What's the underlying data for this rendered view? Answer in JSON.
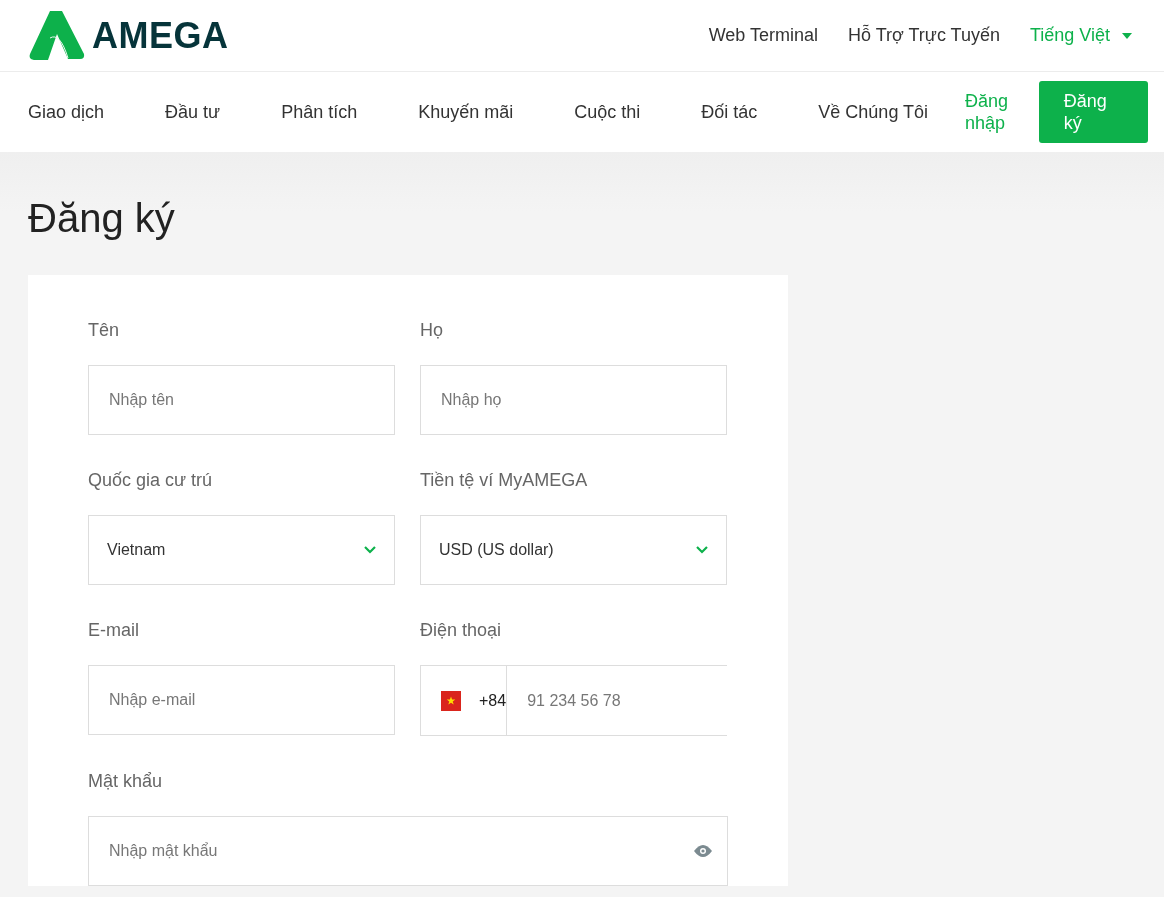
{
  "header": {
    "logo": "AMEGA",
    "top_links": [
      "Web Terminal",
      "Hỗ Trợ Trực Tuyến"
    ],
    "language": "Tiếng Việt"
  },
  "nav": {
    "items": [
      "Giao dịch",
      "Đầu tư",
      "Phân tích",
      "Khuyến mãi",
      "Cuộc thi",
      "Đối tác",
      "Về Chúng Tôi"
    ],
    "login": "Đăng nhập",
    "register": "Đăng ký"
  },
  "page_title": "Đăng ký",
  "form": {
    "rows": [
      [
        {
          "kind": "text",
          "label": "Tên",
          "placeholder": "Nhập tên"
        },
        {
          "kind": "text",
          "label": "Họ",
          "placeholder": "Nhập họ"
        }
      ],
      [
        {
          "kind": "select",
          "label": "Quốc gia cư trú",
          "value": "Vietnam"
        },
        {
          "kind": "select",
          "label": "Tiền tệ ví MyAMEGA",
          "value": "USD (US dollar)"
        }
      ],
      [
        {
          "kind": "text",
          "label": "E-mail",
          "placeholder": "Nhập e-mail"
        },
        {
          "kind": "phone",
          "label": "Điện thoại",
          "code": "+84",
          "placeholder": "91 234 56 78"
        }
      ],
      [
        {
          "kind": "password",
          "label": "Mật khẩu",
          "placeholder": "Nhập mật khẩu"
        }
      ]
    ]
  }
}
